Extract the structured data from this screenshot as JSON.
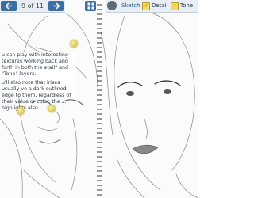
{
  "toolbar_left": {
    "page_indicator": "9 of 11"
  },
  "toolbar_right": {
    "tabs": [
      {
        "label": "Sketch",
        "active": true
      },
      {
        "label": "Detail",
        "checked": true
      },
      {
        "label": "Tone",
        "checked": true
      }
    ]
  },
  "tip": {
    "paragraph1": "u can play with interesting textures working back and forth in both the etail\" and \"Tone\" layers.",
    "paragraph2": "u'll also note that irises usually ve a dark outlined edge to them, regardless of their value or color. the ... highlights also"
  },
  "colors": {
    "toolbar_bg": "#e9eef4",
    "accent": "#3a6ea5",
    "check": "#f2dc5d"
  }
}
